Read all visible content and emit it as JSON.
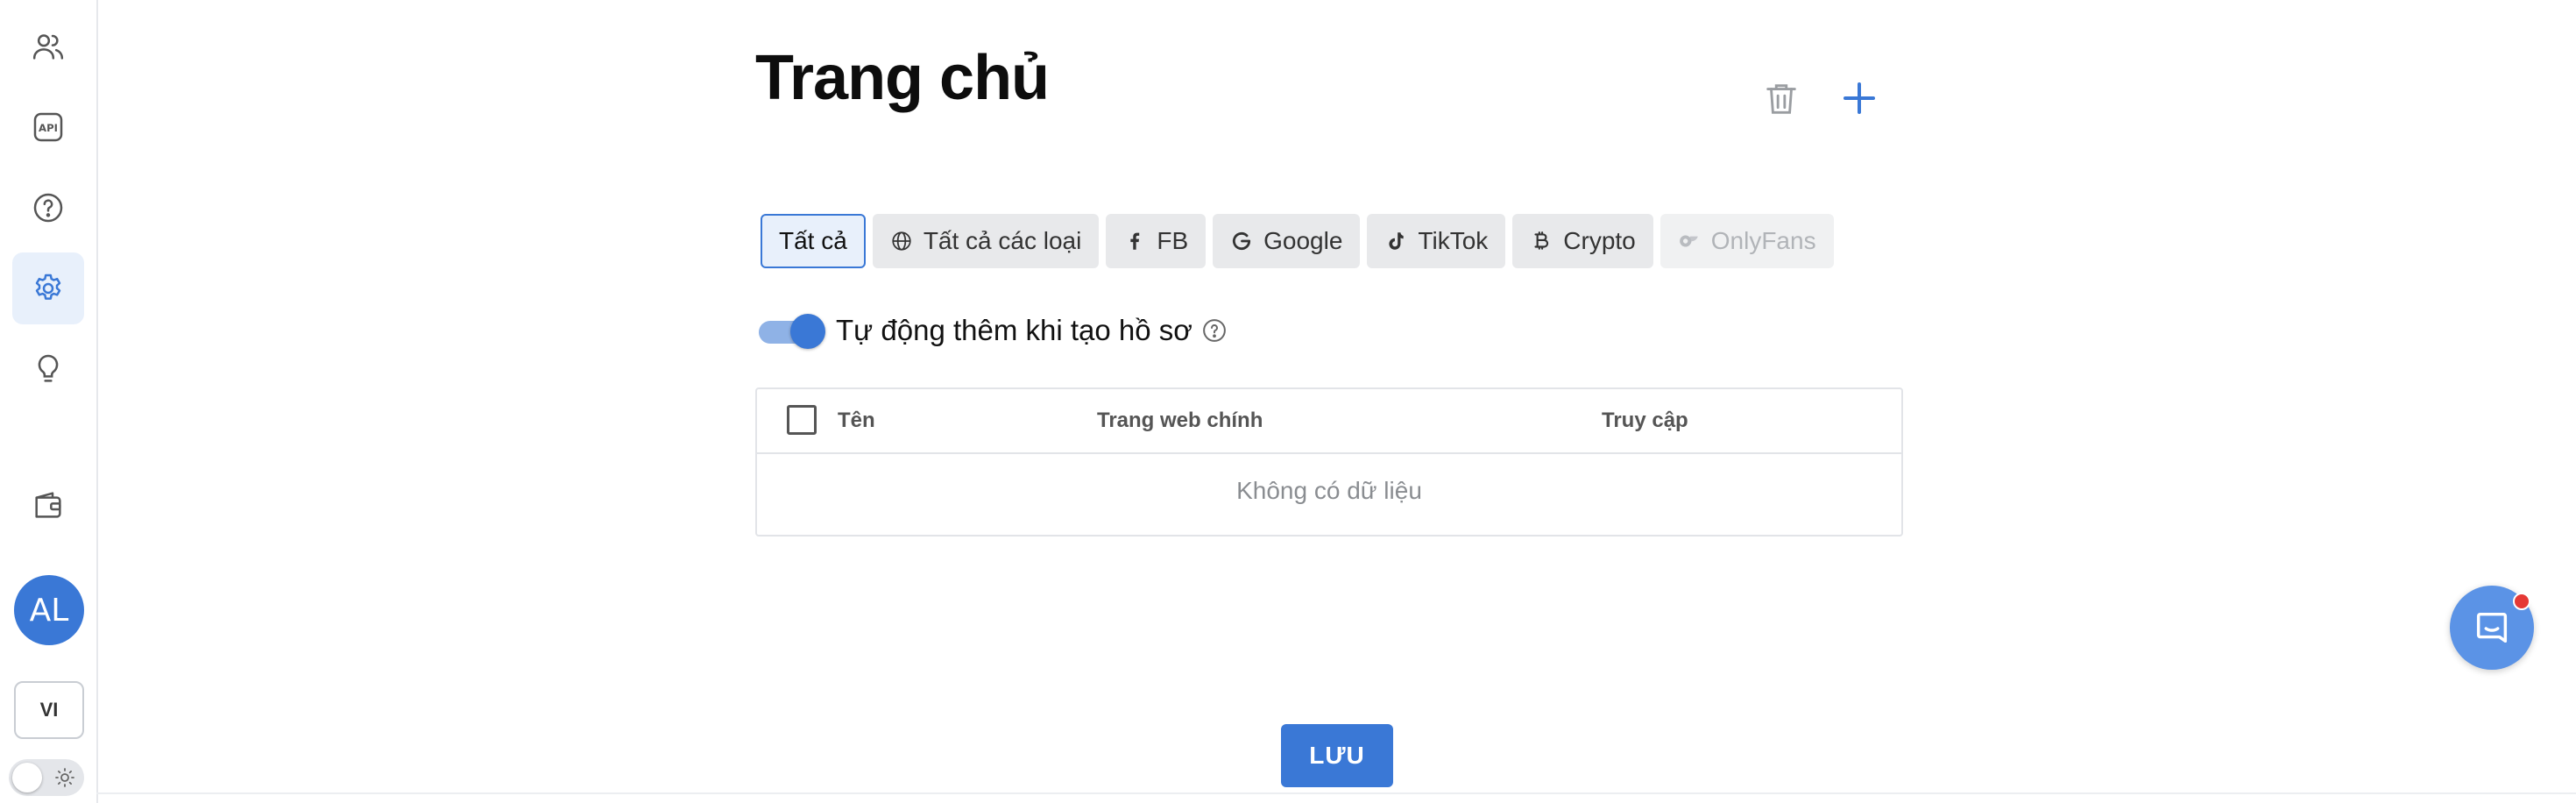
{
  "sidebar": {
    "items": [
      {
        "icon": "users-icon"
      },
      {
        "icon": "api-icon",
        "text": "API"
      },
      {
        "icon": "help-icon"
      },
      {
        "icon": "settings-icon",
        "active": true
      },
      {
        "icon": "lightbulb-icon"
      },
      {
        "icon": "wallet-icon"
      }
    ],
    "avatar": "AL",
    "language": "VI"
  },
  "page": {
    "title": "Trang chủ"
  },
  "tabs": [
    {
      "label": "Tất cả",
      "icon": "",
      "state": "active"
    },
    {
      "label": "Tất cả các loại",
      "icon": "globe-icon",
      "state": "normal"
    },
    {
      "label": "FB",
      "icon": "facebook-icon",
      "state": "normal"
    },
    {
      "label": "Google",
      "icon": "google-icon",
      "state": "normal"
    },
    {
      "label": "TikTok",
      "icon": "tiktok-icon",
      "state": "normal"
    },
    {
      "label": "Crypto",
      "icon": "bitcoin-icon",
      "state": "normal"
    },
    {
      "label": "OnlyFans",
      "icon": "onlyfans-icon",
      "state": "disabled"
    }
  ],
  "auto_add": {
    "label": "Tự động thêm khi tạo hồ sơ",
    "enabled": true
  },
  "table": {
    "columns": [
      "Tên",
      "Trang web chính",
      "Truy cập"
    ],
    "empty_text": "Không có dữ liệu"
  },
  "save_button": "LƯU",
  "colors": {
    "accent": "#3a78d6",
    "active_bg": "#e8f0fb",
    "tab_bg": "#e8e9eb",
    "notification": "#e53935"
  }
}
